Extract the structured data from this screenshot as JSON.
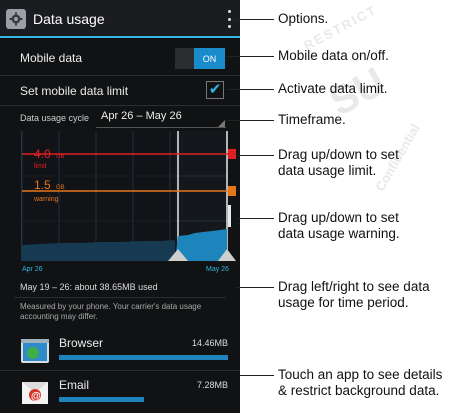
{
  "screen": {
    "title": "Data usage",
    "mobile_data": {
      "label": "Mobile data",
      "toggle": "ON"
    },
    "limit_setting": {
      "label": "Set mobile data limit",
      "checked": true
    },
    "cycle": {
      "label": "Data usage cycle",
      "value": "Apr 26 – May 26"
    },
    "graph": {
      "limit": {
        "value": "4.0",
        "unit": "GB",
        "name": "limit"
      },
      "warning": {
        "value": "1.5",
        "unit": "GB",
        "name": "warning"
      },
      "start_label": "Apr 26",
      "end_label": "May 26",
      "colors": {
        "limit": "#e02020",
        "warning": "#e8761b",
        "usage": "#1d84bc",
        "grid": "#2d5c78"
      }
    },
    "usage_summary": "May 19 – 26: about 38.65MB used",
    "carrier_note": "Measured by your phone. Your carrier's data usage accounting may differ.",
    "apps": [
      {
        "name": "Browser",
        "size": "14.46MB",
        "icon": "globe-icon",
        "usage_fraction": 1.0
      },
      {
        "name": "Email",
        "size": "7.28MB",
        "icon": "email-icon",
        "usage_fraction": 0.5
      }
    ]
  },
  "callouts": [
    "Options.",
    "Mobile data on/off.",
    "Activate data limit.",
    "Timeframe.",
    "Drag up/down to set\ndata usage limit.",
    "Drag up/down to set\ndata usage warning.",
    "Drag left/right to see data\nusage for time period.",
    "Touch an app to see details\n& restrict background data."
  ],
  "watermark": [
    "RESTRICT",
    "SU",
    "Confidential"
  ]
}
